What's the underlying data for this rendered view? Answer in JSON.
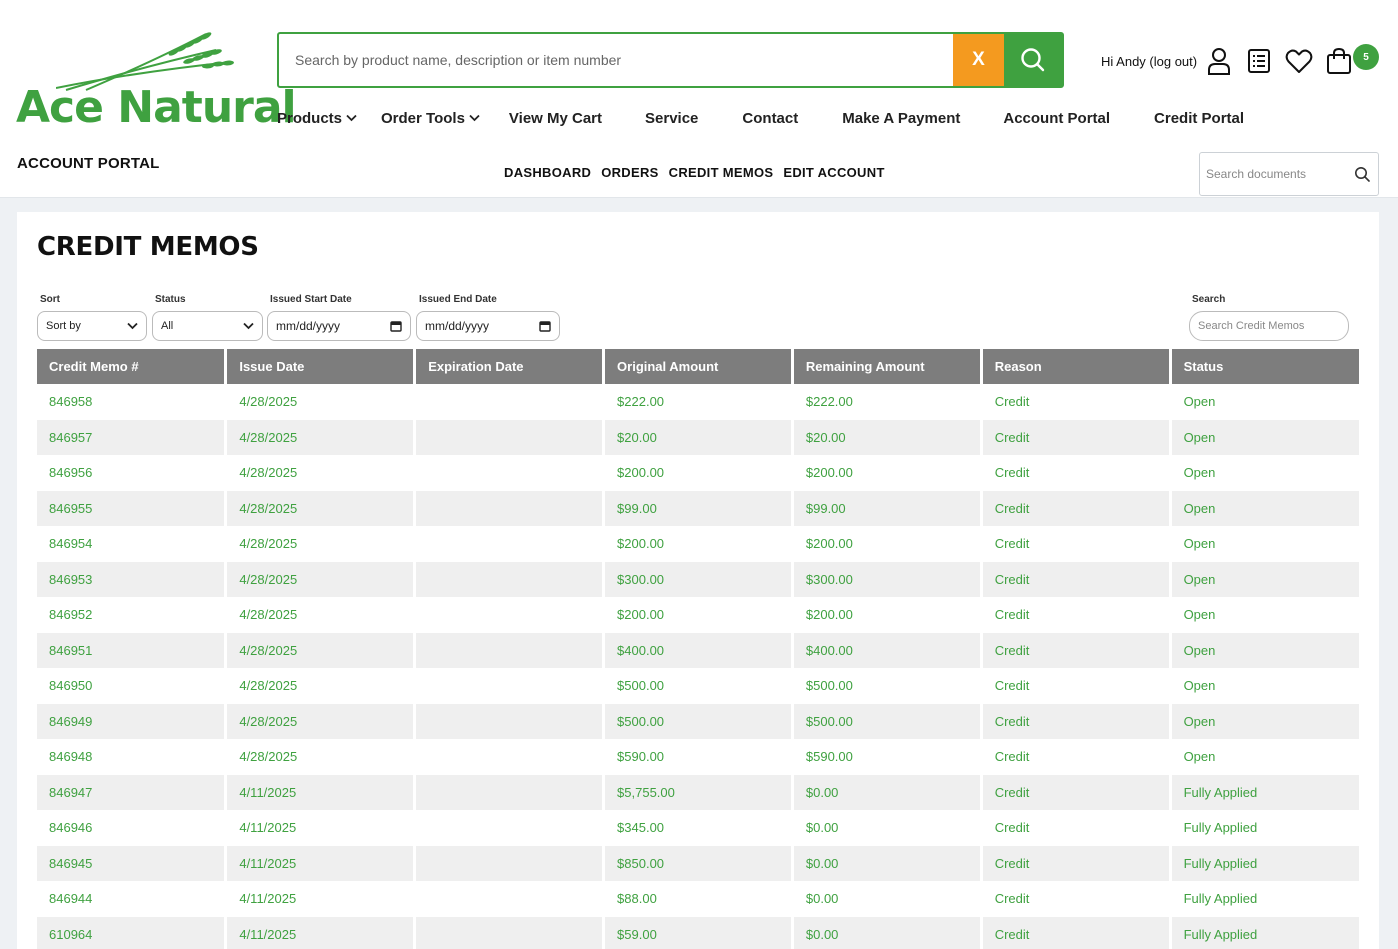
{
  "brand": {
    "name": "Ace Natural",
    "color": "#3fa140",
    "accent": "#f49a1f"
  },
  "search": {
    "placeholder": "Search by product name, description or item number",
    "clear_label": "X"
  },
  "user": {
    "greeting": "Hi  Andy (log out)"
  },
  "cart": {
    "count": "5"
  },
  "nav": {
    "products": "Products",
    "order_tools": "Order Tools",
    "view_cart": "View My Cart",
    "service": "Service",
    "contact": "Contact",
    "make_payment": "Make A Payment",
    "account_portal": "Account Portal",
    "credit_portal": "Credit Portal"
  },
  "portal": {
    "label": "ACCOUNT PORTAL",
    "subnav": {
      "dashboard": "DASHBOARD",
      "orders": "ORDERS",
      "credit_memos": "CREDIT MEMOS",
      "edit_account": "EDIT ACCOUNT"
    },
    "doc_search_placeholder": "Search documents"
  },
  "page": {
    "title": "CREDIT MEMOS"
  },
  "filters": {
    "sort_label": "Sort",
    "sort_value": "Sort by",
    "status_label": "Status",
    "status_value": "All",
    "start_label": "Issued Start Date",
    "start_value": "mm/dd/yyyy",
    "end_label": "Issued End Date",
    "end_value": "mm/dd/yyyy",
    "search_label": "Search",
    "search_placeholder": "Search Credit Memos"
  },
  "table": {
    "columns": [
      "Credit Memo #",
      "Issue Date",
      "Expiration Date",
      "Original Amount",
      "Remaining Amount",
      "Reason",
      "Status"
    ],
    "rows": [
      [
        "846958",
        "4/28/2025",
        "",
        "$222.00",
        "$222.00",
        "Credit",
        "Open"
      ],
      [
        "846957",
        "4/28/2025",
        "",
        "$20.00",
        "$20.00",
        "Credit",
        "Open"
      ],
      [
        "846956",
        "4/28/2025",
        "",
        "$200.00",
        "$200.00",
        "Credit",
        "Open"
      ],
      [
        "846955",
        "4/28/2025",
        "",
        "$99.00",
        "$99.00",
        "Credit",
        "Open"
      ],
      [
        "846954",
        "4/28/2025",
        "",
        "$200.00",
        "$200.00",
        "Credit",
        "Open"
      ],
      [
        "846953",
        "4/28/2025",
        "",
        "$300.00",
        "$300.00",
        "Credit",
        "Open"
      ],
      [
        "846952",
        "4/28/2025",
        "",
        "$200.00",
        "$200.00",
        "Credit",
        "Open"
      ],
      [
        "846951",
        "4/28/2025",
        "",
        "$400.00",
        "$400.00",
        "Credit",
        "Open"
      ],
      [
        "846950",
        "4/28/2025",
        "",
        "$500.00",
        "$500.00",
        "Credit",
        "Open"
      ],
      [
        "846949",
        "4/28/2025",
        "",
        "$500.00",
        "$500.00",
        "Credit",
        "Open"
      ],
      [
        "846948",
        "4/28/2025",
        "",
        "$590.00",
        "$590.00",
        "Credit",
        "Open"
      ],
      [
        "846947",
        "4/11/2025",
        "",
        "$5,755.00",
        "$0.00",
        "Credit",
        "Fully Applied"
      ],
      [
        "846946",
        "4/11/2025",
        "",
        "$345.00",
        "$0.00",
        "Credit",
        "Fully Applied"
      ],
      [
        "846945",
        "4/11/2025",
        "",
        "$850.00",
        "$0.00",
        "Credit",
        "Fully Applied"
      ],
      [
        "846944",
        "4/11/2025",
        "",
        "$88.00",
        "$0.00",
        "Credit",
        "Fully Applied"
      ],
      [
        "610964",
        "4/11/2025",
        "",
        "$59.00",
        "$0.00",
        "Credit",
        "Fully Applied"
      ]
    ]
  }
}
